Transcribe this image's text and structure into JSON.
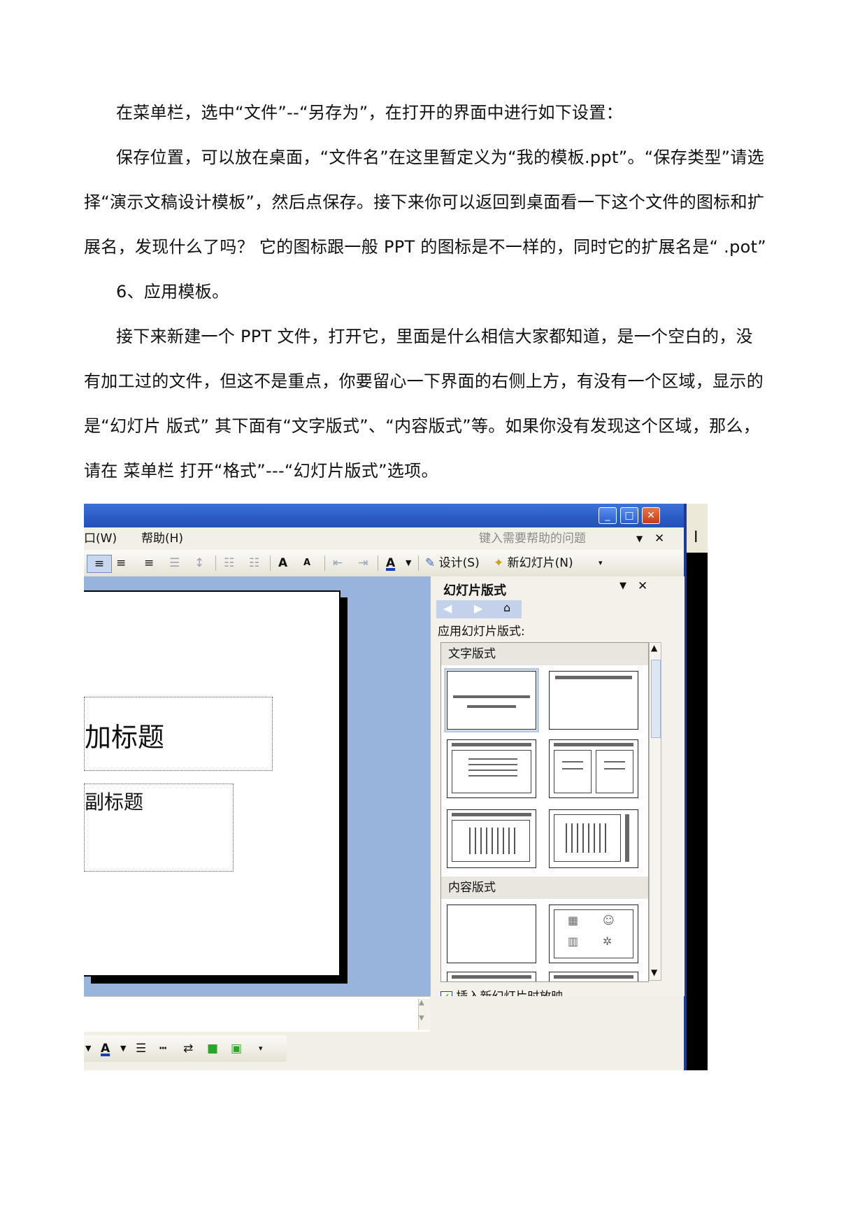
{
  "paragraphs": [
    "在菜单栏，选中“文件”--“另存为”，在打开的界面中进行如下设置：",
    "保存位置，可以放在桌面，“文件名”在这里暂定义为“我的模板.ppt”。“保存类型”请选",
    "择“演示文稿设计模板”，然后点保存。接下来你可以返回到桌面看一下这个文件的图标和扩",
    "展名，发现什么了吗？ 它的图标跟一般 PPT 的图标是不一样的，同时它的扩展名是“ .pot”",
    "6、应用模板。",
    "接下来新建一个 PPT 文件，打开它，里面是什么相信大家都知道，是一个空白的，没",
    "有加工过的文件，但这不是重点，你要留心一下界面的右侧上方，有没有一个区域，显示的",
    "是“幻灯片 版式”    其下面有“文字版式”、“内容版式”等。如果你没有发现这个区域，那么，",
    "请在 菜单栏 打开“格式”---“幻灯片版式”选项。"
  ],
  "screenshot": {
    "menu": {
      "window": "口(W)",
      "help": "帮助(H)",
      "search_placeholder": "键入需要帮助的问题",
      "right_edge_char": "I"
    },
    "toolbar": {
      "design": "设计(S)",
      "new_slide": "新幻灯片(N)"
    },
    "slide": {
      "title_placeholder": "加标题",
      "subtitle_placeholder": "副标题"
    },
    "task_pane": {
      "title": "幻灯片版式",
      "apply_label": "应用幻灯片版式:",
      "text_layouts_header": "文字版式",
      "content_layouts_header": "内容版式",
      "checkbox_label": "插入新幻灯片时放映",
      "checkbox_checked": true
    }
  }
}
